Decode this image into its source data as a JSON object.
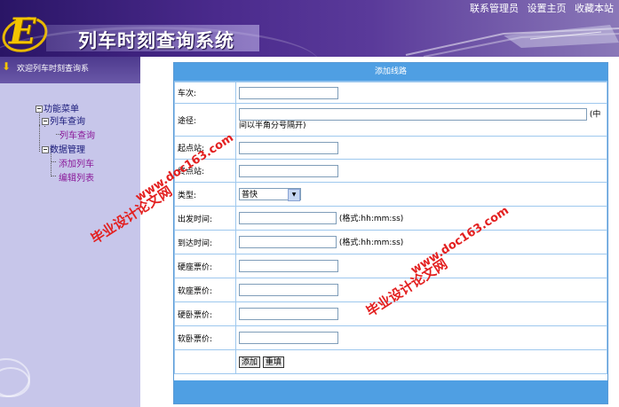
{
  "header": {
    "logo_letter": "E",
    "app_title": "列车时刻查询系统",
    "top_links": [
      "联系管理员",
      "设置主页",
      "收藏本站"
    ]
  },
  "sidebar": {
    "welcome": "欢迎列车时刻查询系",
    "tree": {
      "root": "功能菜单",
      "query_group": "列车查询",
      "query_item": "列车查询",
      "data_group": "数据管理",
      "add_train": "添加列车",
      "edit_list": "编辑列表"
    }
  },
  "form": {
    "title": "添加线路",
    "fields": {
      "train_no": "车次:",
      "route": "途径:",
      "route_hint_a": "(中",
      "route_hint_b": "间以半角分号隔开)",
      "start_station": "起点站:",
      "end_station": "终点站:",
      "type": "类型:",
      "type_value": "普快",
      "depart_time": "出发时间:",
      "arrive_time": "到达时间:",
      "time_format": "(格式:hh:mm:ss)",
      "hard_seat": "硬座票价:",
      "soft_seat": "软座票价:",
      "hard_sleeper": "硬卧票价:",
      "soft_sleeper": "软卧票价:"
    },
    "buttons": {
      "add": "添加",
      "reset": "重填"
    }
  },
  "watermarks": {
    "url": "www.doc163.com",
    "text": "毕业设计论文网"
  },
  "colors": {
    "header_purple": "#4a2a8c",
    "sidebar_lavender": "#c7c6ea",
    "panel_blue": "#4f9fe3",
    "border_blue": "#9ec8ee",
    "watermark_red": "#e32020"
  }
}
